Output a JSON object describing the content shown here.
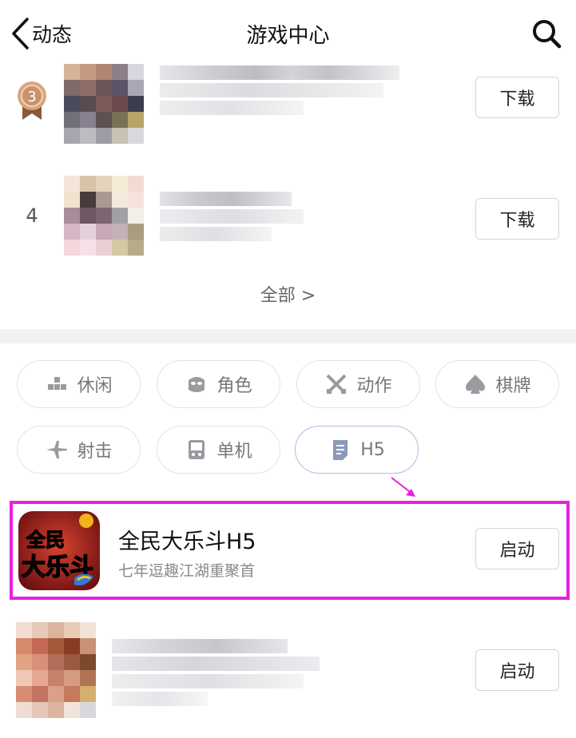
{
  "header": {
    "back_label": "动态",
    "title": "游戏中心"
  },
  "colors": {
    "highlight": "#e820e0",
    "badge_bronze": "#c8926a",
    "page_bg": "#ffffff"
  },
  "rank_list": [
    {
      "rank": "3",
      "rank_style": "bronze-medal",
      "button": "下载"
    },
    {
      "rank": "4",
      "rank_style": "plain",
      "button": "下载"
    }
  ],
  "all_link": "全部 >",
  "categories": [
    {
      "label": "休闲",
      "icon": "blocks-icon"
    },
    {
      "label": "角色",
      "icon": "mask-icon"
    },
    {
      "label": "动作",
      "icon": "swords-icon"
    },
    {
      "label": "棋牌",
      "icon": "spade-icon"
    },
    {
      "label": "射击",
      "icon": "plane-icon"
    },
    {
      "label": "单机",
      "icon": "console-icon"
    },
    {
      "label": "H5",
      "icon": "document-icon"
    }
  ],
  "featured_game": {
    "name": "全民大乐斗H5",
    "description": "七年逗趣江湖重聚首",
    "button": "启动",
    "icon_text": "全民大乐斗"
  },
  "bottom_game": {
    "button": "启动"
  }
}
